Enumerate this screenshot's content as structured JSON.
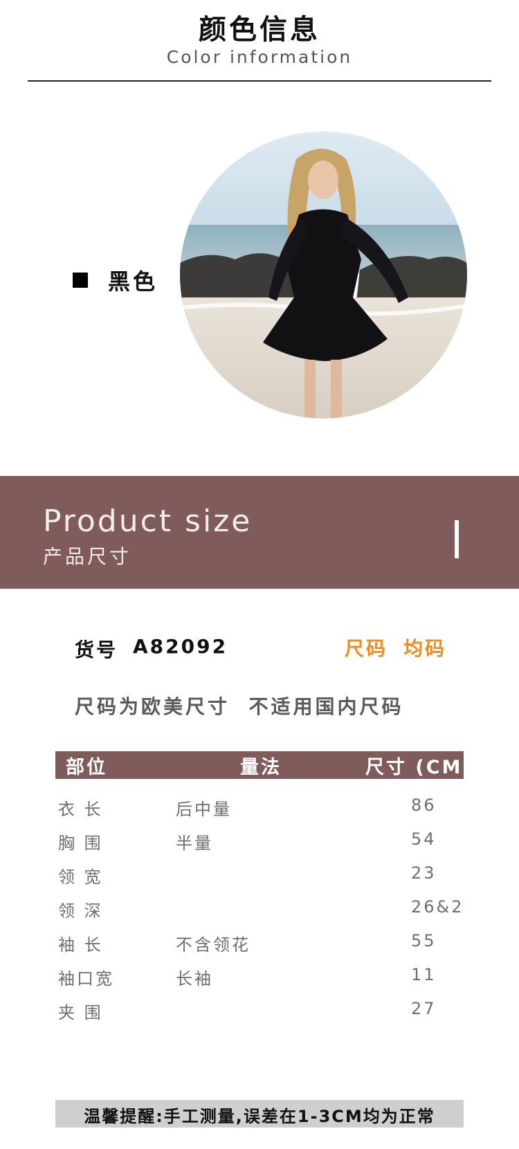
{
  "header": {
    "title_cn": "颜色信息",
    "title_en": "Color information"
  },
  "color": {
    "name": "黑色",
    "swatch_color": "#000000"
  },
  "banner": {
    "title_en": "Product size",
    "title_cn": "产品尺寸",
    "background": "#7f5b5b"
  },
  "item": {
    "label": "货号",
    "number": "A82092",
    "size_label": "尺码",
    "size_value": "均码",
    "accent": "#f08c1e"
  },
  "note": "尺码为欧美尺寸  不适用国内尺码",
  "table": {
    "headers": {
      "part": "部位",
      "method": "量法",
      "size": "尺寸 (CM)"
    },
    "rows": [
      {
        "part": "衣  长",
        "method": "后中量",
        "value": "86"
      },
      {
        "part": "胸  围",
        "method": "半量",
        "value": "54"
      },
      {
        "part": "领  宽",
        "method": "",
        "value": "23"
      },
      {
        "part": "领  深",
        "method": "",
        "value": "26&2"
      },
      {
        "part": "袖  长",
        "method": "不含领花",
        "value": "55"
      },
      {
        "part": "袖口宽",
        "method": "长袖",
        "value": "11"
      },
      {
        "part": "夹  围",
        "method": "",
        "value": "27"
      }
    ]
  },
  "reminder": "温馨提醒:手工测量,误差在1-3CM均为正常"
}
